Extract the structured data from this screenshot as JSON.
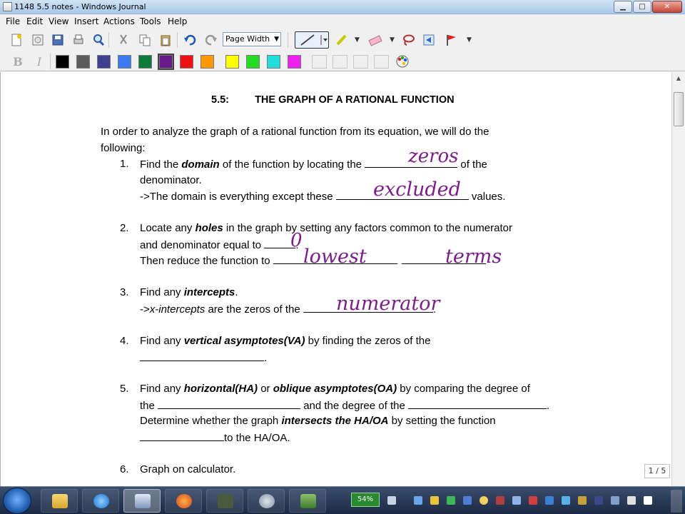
{
  "window": {
    "title": "1148 5.5 notes - Windows Journal",
    "controls": {
      "minimize": "▁",
      "maximize": "□",
      "close": "✕"
    }
  },
  "menu": {
    "items": [
      "File",
      "Edit",
      "View",
      "Insert",
      "Actions",
      "Tools",
      "Help"
    ]
  },
  "toolbar": {
    "zoom_value": "Page Width",
    "colors": [
      "#000000",
      "#5c5c5c",
      "#3f3f8f",
      "#3c7cf2",
      "#0b7a3b",
      "#6a1a8a",
      "#ee1111",
      "#ff9900",
      "#ffff00",
      "#22dd22",
      "#22dddd",
      "#ee22ee"
    ]
  },
  "document": {
    "title_number": "5.5:",
    "title_text": "THE GRAPH OF A RATIONAL FUNCTION",
    "intro_line1": "In order to analyze the graph of a rational function from its equation, we will do the",
    "intro_line2": "following:",
    "item1": {
      "num": "1.",
      "a": "Find the ",
      "b": "domain",
      "c": " of the function by locating the ",
      "d": " of the",
      "line2": "denominator.",
      "line3a": "->The domain is everything except these ",
      "line3b": " values.",
      "hw1": "zeros",
      "hw2": "excluded"
    },
    "item2": {
      "num": "2.",
      "a": "Locate any ",
      "b": "holes",
      "c": " in the graph by setting any factors common to the numerator",
      "line2a": "and denominator equal to ",
      "line2b": ".",
      "line3a": "Then reduce the function to ",
      "hw1": "0",
      "hw2": "lowest",
      "hw3": "terms"
    },
    "item3": {
      "num": "3.",
      "a": "Find any ",
      "b": "intercepts",
      "c": ".",
      "line2a": "->",
      "line2b": "x-intercepts",
      "line2c": " are the zeros of the ",
      "line2d": ".",
      "hw1": "numerator"
    },
    "item4": {
      "num": "4.",
      "a": "Find any ",
      "b": "vertical asymptotes(VA)",
      "c": " by finding the zeros of the",
      "line2b": "."
    },
    "item5": {
      "num": "5.",
      "a": "Find any ",
      "b": "horizontal(HA)",
      "c": " or ",
      "d": "oblique asymptotes(OA)",
      "e": " by comparing the degree of",
      "line2a": "the ",
      "line2b": " and the degree of the ",
      "line2c": ".",
      "line3a": "Determine whether the graph ",
      "line3b": "intersects the HA/OA",
      "line3c": " by setting the function",
      "line4b": "to the HA/OA."
    },
    "item6": {
      "num": "6.",
      "a": "Graph on calculator."
    }
  },
  "page_indicator": "1 / 5",
  "taskbar": {
    "battery": "54%"
  }
}
